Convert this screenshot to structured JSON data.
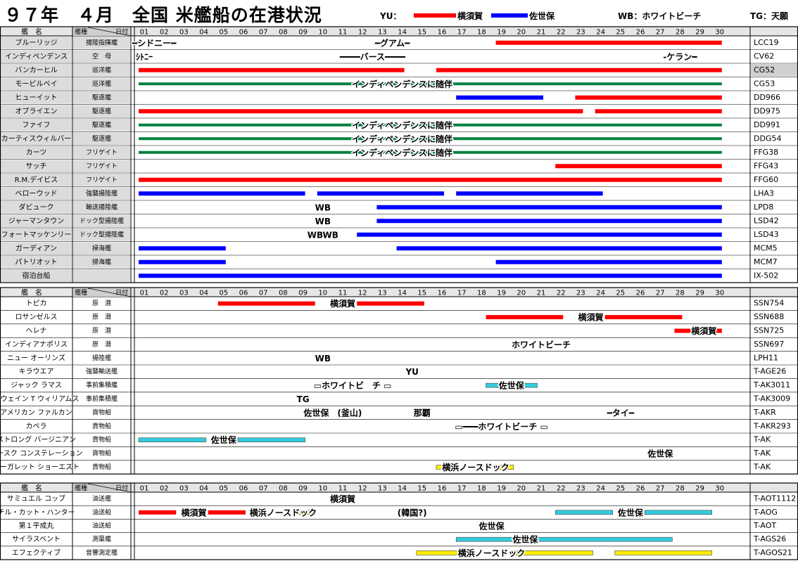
{
  "header": {
    "title": "９７年　４月　全国 米艦船の在港状況",
    "legend": {
      "yu": "YU：",
      "yokosuka": "横須賀",
      "sasebo": "佐世保",
      "wb": "WB：ホワイトビーチ",
      "tg": "TG：天願"
    }
  },
  "colors": {
    "yokosuka": "#ff0000",
    "sasebo": "#0000ff",
    "escort": "#008040",
    "cyan": "#33ccdd",
    "yellow": "#ffee00",
    "grid": "#000000",
    "shade": "#d0d0d0"
  },
  "chart_data": {
    "type": "gantt",
    "x_ticks": [
      "01",
      "02",
      "03",
      "04",
      "05",
      "06",
      "07",
      "08",
      "09",
      "10",
      "11",
      "12",
      "13",
      "14",
      "15",
      "16",
      "17",
      "18",
      "19",
      "20",
      "21",
      "22",
      "23",
      "24",
      "25",
      "26",
      "27",
      "28",
      "29",
      "30"
    ],
    "column_headers": {
      "name": "艦　名",
      "type": "艦種",
      "day": "日付"
    },
    "sections": [
      {
        "rows": [
          {
            "name": "ブルーリッジ",
            "type": "揚陸指揮艦",
            "hull": "LCC19",
            "bars": [
              {
                "color": "yokosuka",
                "start": 19,
                "end": 30
              }
            ],
            "texts": [
              {
                "t": "━シドニー━",
                "x": 1.5
              },
              {
                "t": "━グアム━",
                "x": 13.5
              }
            ]
          },
          {
            "name": "インディペンデンス",
            "type": "空　母",
            "hull": "CV62",
            "bars": [],
            "texts": [
              {
                "t": "ｼﾄﾆｰ",
                "x": 0.2
              },
              {
                "t": "━━━━バース━━━━",
                "x": 12.5
              },
              {
                "t": "-ケラン━",
                "x": 28
              }
            ]
          },
          {
            "name": "バンカーヒル",
            "type": "巡洋艦",
            "hull": "CG52",
            "shade": true,
            "bars": [
              {
                "color": "yokosuka",
                "start": 1,
                "end": 14
              },
              {
                "color": "yokosuka",
                "start": 16,
                "end": 30
              }
            ]
          },
          {
            "name": "モービルベイ",
            "type": "巡洋艦",
            "hull": "CG53",
            "bars": [
              {
                "color": "escort",
                "start": 1,
                "end": 30
              }
            ],
            "texts": [
              {
                "t": "インディペンデンスに随伴",
                "x": 14
              }
            ]
          },
          {
            "name": "ヒューイット",
            "type": "駆逐艦",
            "hull": "DD966",
            "bars": [
              {
                "color": "sasebo",
                "start": 17,
                "end": 21
              },
              {
                "color": "yokosuka",
                "start": 23,
                "end": 30
              }
            ]
          },
          {
            "name": "オブライエン",
            "type": "駆逐艦",
            "hull": "DD975",
            "bars": [
              {
                "color": "yokosuka",
                "start": 1,
                "end": 23
              },
              {
                "color": "yokosuka",
                "start": 24,
                "end": 30
              }
            ]
          },
          {
            "name": "ファイフ",
            "type": "駆逐艦",
            "hull": "DD991",
            "bars": [
              {
                "color": "escort",
                "start": 1,
                "end": 30
              }
            ],
            "texts": [
              {
                "t": "インディペンデンスに随伴",
                "x": 14
              }
            ]
          },
          {
            "name": "カーティスウィルバー",
            "type": "駆逐艦",
            "hull": "DDG54",
            "bars": [
              {
                "color": "escort",
                "start": 1,
                "end": 30
              }
            ],
            "texts": [
              {
                "t": "インディペンデンスに随伴",
                "x": 14
              }
            ]
          },
          {
            "name": "カーツ",
            "type": "フリゲイト",
            "hull": "FFG38",
            "bars": [
              {
                "color": "escort",
                "start": 1,
                "end": 30
              }
            ],
            "texts": [
              {
                "t": "インディペンデンスに随伴",
                "x": 14
              }
            ]
          },
          {
            "name": "サッチ",
            "type": "フリゲイト",
            "hull": "FFG43",
            "bars": [
              {
                "color": "yokosuka",
                "start": 22,
                "end": 30
              }
            ]
          },
          {
            "name": "R.M.デイビス",
            "type": "フリゲイト",
            "hull": "FFG60",
            "bars": [
              {
                "color": "yokosuka",
                "start": 1,
                "end": 30
              }
            ]
          },
          {
            "name": "ベローウッド",
            "type": "強襲揚陸艦",
            "hull": "LHA3",
            "bars": [
              {
                "color": "sasebo",
                "start": 1,
                "end": 9
              },
              {
                "color": "sasebo",
                "start": 10,
                "end": 16
              },
              {
                "color": "sasebo",
                "start": 17,
                "end": 24
              }
            ]
          },
          {
            "name": "ダビューク",
            "type": "輸送揚陸艦",
            "hull": "LPD8",
            "bars": [
              {
                "color": "sasebo",
                "start": 13,
                "end": 30
              }
            ],
            "texts": [
              {
                "t": "WB",
                "x": 10
              }
            ]
          },
          {
            "name": "ジャーマンタウン",
            "type": "ドック型揚陸艦",
            "hull": "LSD42",
            "bars": [
              {
                "color": "sasebo",
                "start": 13,
                "end": 30
              }
            ],
            "texts": [
              {
                "t": "WB",
                "x": 10
              }
            ]
          },
          {
            "name": "フォートマッケンリー",
            "type": "ドック型揚陸艦",
            "hull": "LSD43",
            "bars": [
              {
                "color": "sasebo",
                "start": 12,
                "end": 30
              }
            ],
            "texts": [
              {
                "t": "WBWB",
                "x": 10
              }
            ]
          },
          {
            "name": "ガーディアン",
            "type": "掃海艦",
            "hull": "MCM5",
            "bars": [
              {
                "color": "sasebo",
                "start": 1,
                "end": 5
              },
              {
                "color": "sasebo",
                "start": 14,
                "end": 30
              }
            ]
          },
          {
            "name": "パトリオット",
            "type": "掃海艦",
            "hull": "MCM7",
            "bars": [
              {
                "color": "sasebo",
                "start": 1,
                "end": 5
              },
              {
                "color": "sasebo",
                "start": 19,
                "end": 30
              }
            ]
          },
          {
            "name": "宿泊台船",
            "type": "",
            "hull": "IX-502",
            "bars": [
              {
                "color": "sasebo",
                "start": 1,
                "end": 30
              }
            ]
          }
        ]
      },
      {
        "rows": [
          {
            "name": "トピカ",
            "type": "原　潜",
            "hull": "SSN754",
            "bars": [
              {
                "color": "yokosuka",
                "start": 5,
                "end": 9.5
              },
              {
                "color": "yokosuka",
                "start": 12,
                "end": 15
              }
            ],
            "texts": [
              {
                "t": "横須賀",
                "x": 11
              }
            ]
          },
          {
            "name": "ロサンゼルス",
            "type": "原　潜",
            "hull": "SSN688",
            "bars": [
              {
                "color": "yokosuka",
                "start": 18.5,
                "end": 22
              },
              {
                "color": "yokosuka",
                "start": 24.5,
                "end": 28
              }
            ],
            "texts": [
              {
                "t": "横須賀",
                "x": 23.5
              }
            ]
          },
          {
            "name": "ヘレナ",
            "type": "原　潜",
            "hull": "SSN725",
            "bars": [
              {
                "color": "yokosuka",
                "start": 28,
                "end": 28.8
              },
              {
                "color": "yokosuka",
                "start": 29.5,
                "end": 30
              }
            ],
            "texts": [
              {
                "t": "横須賀",
                "x": 29.2
              }
            ]
          },
          {
            "name": "インディアナポリス",
            "type": "原　潜",
            "hull": "SSN697",
            "bars": [],
            "texts": [
              {
                "t": "ホワイトビーチ",
                "x": 21
              }
            ]
          },
          {
            "name": "ニュー オーリンズ",
            "type": "揚陸艦",
            "hull": "LPH11",
            "bars": [],
            "texts": [
              {
                "t": "WB",
                "x": 10
              }
            ]
          },
          {
            "name": "キラウエア",
            "type": "強襲輸送艦",
            "hull": "T-AGE26",
            "bars": [],
            "texts": [
              {
                "t": "YU",
                "x": 14.5
              }
            ]
          },
          {
            "name": "ジャック ラマス",
            "type": "事前集積艦",
            "hull": "T-AK3011",
            "bars": [
              {
                "color": "cyan",
                "start": 18.5,
                "end": 19
              },
              {
                "color": "cyan",
                "start": 20,
                "end": 20.7
              }
            ],
            "texts": [
              {
                "t": "▭ホワイトビ　チ ▭",
                "x": 11.5
              },
              {
                "t": "佐世保",
                "x": 19.5
              }
            ]
          },
          {
            "name": "ドウェイン T ウィリアムス",
            "type": "事前集積艦",
            "hull": "T-AK3009",
            "bars": [],
            "texts": [
              {
                "t": "TG",
                "x": 9
              }
            ]
          },
          {
            "name": "アメリカン ファルカン",
            "type": "貨物船",
            "hull": "T-AKR",
            "bars": [],
            "texts": [
              {
                "t": "佐世保　(釜山)",
                "x": 10.5
              },
              {
                "t": "那覇",
                "x": 15
              },
              {
                "t": "━タイ━",
                "x": 25
              }
            ]
          },
          {
            "name": "カペラ",
            "type": "貨物船",
            "hull": "T-AKR293",
            "bars": [],
            "texts": [
              {
                "t": "▭━━━ホワイトビーチ ▭",
                "x": 19
              }
            ]
          },
          {
            "name": "ストロング バージニアン",
            "type": "貨物船",
            "hull": "T-AK",
            "bars": [
              {
                "color": "cyan",
                "start": 1,
                "end": 4
              },
              {
                "color": "cyan",
                "start": 6,
                "end": 9
              }
            ],
            "texts": [
              {
                "t": "佐世保",
                "x": 5
              }
            ]
          },
          {
            "name": "マースク コンステレーション",
            "type": "貨物船",
            "hull": "T-AK",
            "bars": [],
            "texts": [
              {
                "t": "佐世保",
                "x": 27
              }
            ]
          },
          {
            "name": "マーガレット ショーエスト",
            "type": "貨物船",
            "hull": "T-AK",
            "bars": [
              {
                "color": "yellow",
                "start": 16,
                "end": 16.5
              },
              {
                "color": "yellow",
                "start": 19,
                "end": 19.5
              }
            ],
            "texts": [
              {
                "t": "横浜ノースドック",
                "x": 17.7
              }
            ]
          }
        ]
      },
      {
        "rows": [
          {
            "name": "サミュエル コッブ",
            "type": "油送艦",
            "hull": "T-AOT1112",
            "bars": [],
            "texts": [
              {
                "t": "横須賀",
                "x": 11
              }
            ]
          },
          {
            "name": "チル・カット・ハンター",
            "type": "油送船",
            "hull": "T-AOG",
            "bars": [
              {
                "color": "yokosuka",
                "start": 1,
                "end": 2.5
              },
              {
                "color": "yokosuka",
                "start": 4.5,
                "end": 6
              },
              {
                "color": "yellow",
                "start": 6.7,
                "end": 7
              },
              {
                "color": "yellow",
                "start": 9,
                "end": 9.5
              },
              {
                "color": "cyan",
                "start": 22,
                "end": 24.5
              },
              {
                "color": "cyan",
                "start": 26.5,
                "end": 29.5
              }
            ],
            "texts": [
              {
                "t": "横須賀",
                "x": 3.5
              },
              {
                "t": "横浜ノースドック",
                "x": 8
              },
              {
                "t": "(韓国?)",
                "x": 14.5
              },
              {
                "t": "佐世保",
                "x": 25.5
              }
            ]
          },
          {
            "name": "第１平成丸",
            "type": "油送船",
            "hull": "T-AOT",
            "bars": [],
            "texts": [
              {
                "t": "佐世保",
                "x": 18.5
              }
            ]
          },
          {
            "name": "サイラスベント",
            "type": "測量艦",
            "hull": "T-AGS26",
            "bars": [
              {
                "color": "cyan",
                "start": 17,
                "end": 19.5
              },
              {
                "color": "cyan",
                "start": 21,
                "end": 27.5
              }
            ],
            "texts": [
              {
                "t": "佐世保",
                "x": 20.2
              }
            ]
          },
          {
            "name": "エフェクティブ",
            "type": "音響測定艦",
            "hull": "T-AGOS21",
            "bars": [
              {
                "color": "yellow",
                "start": 15,
                "end": 16.8
              },
              {
                "color": "yellow",
                "start": 20,
                "end": 23.5
              },
              {
                "color": "yellow",
                "start": 25,
                "end": 29.5
              }
            ],
            "texts": [
              {
                "t": "横浜ノースドック",
                "x": 18.5
              }
            ]
          }
        ]
      }
    ]
  }
}
